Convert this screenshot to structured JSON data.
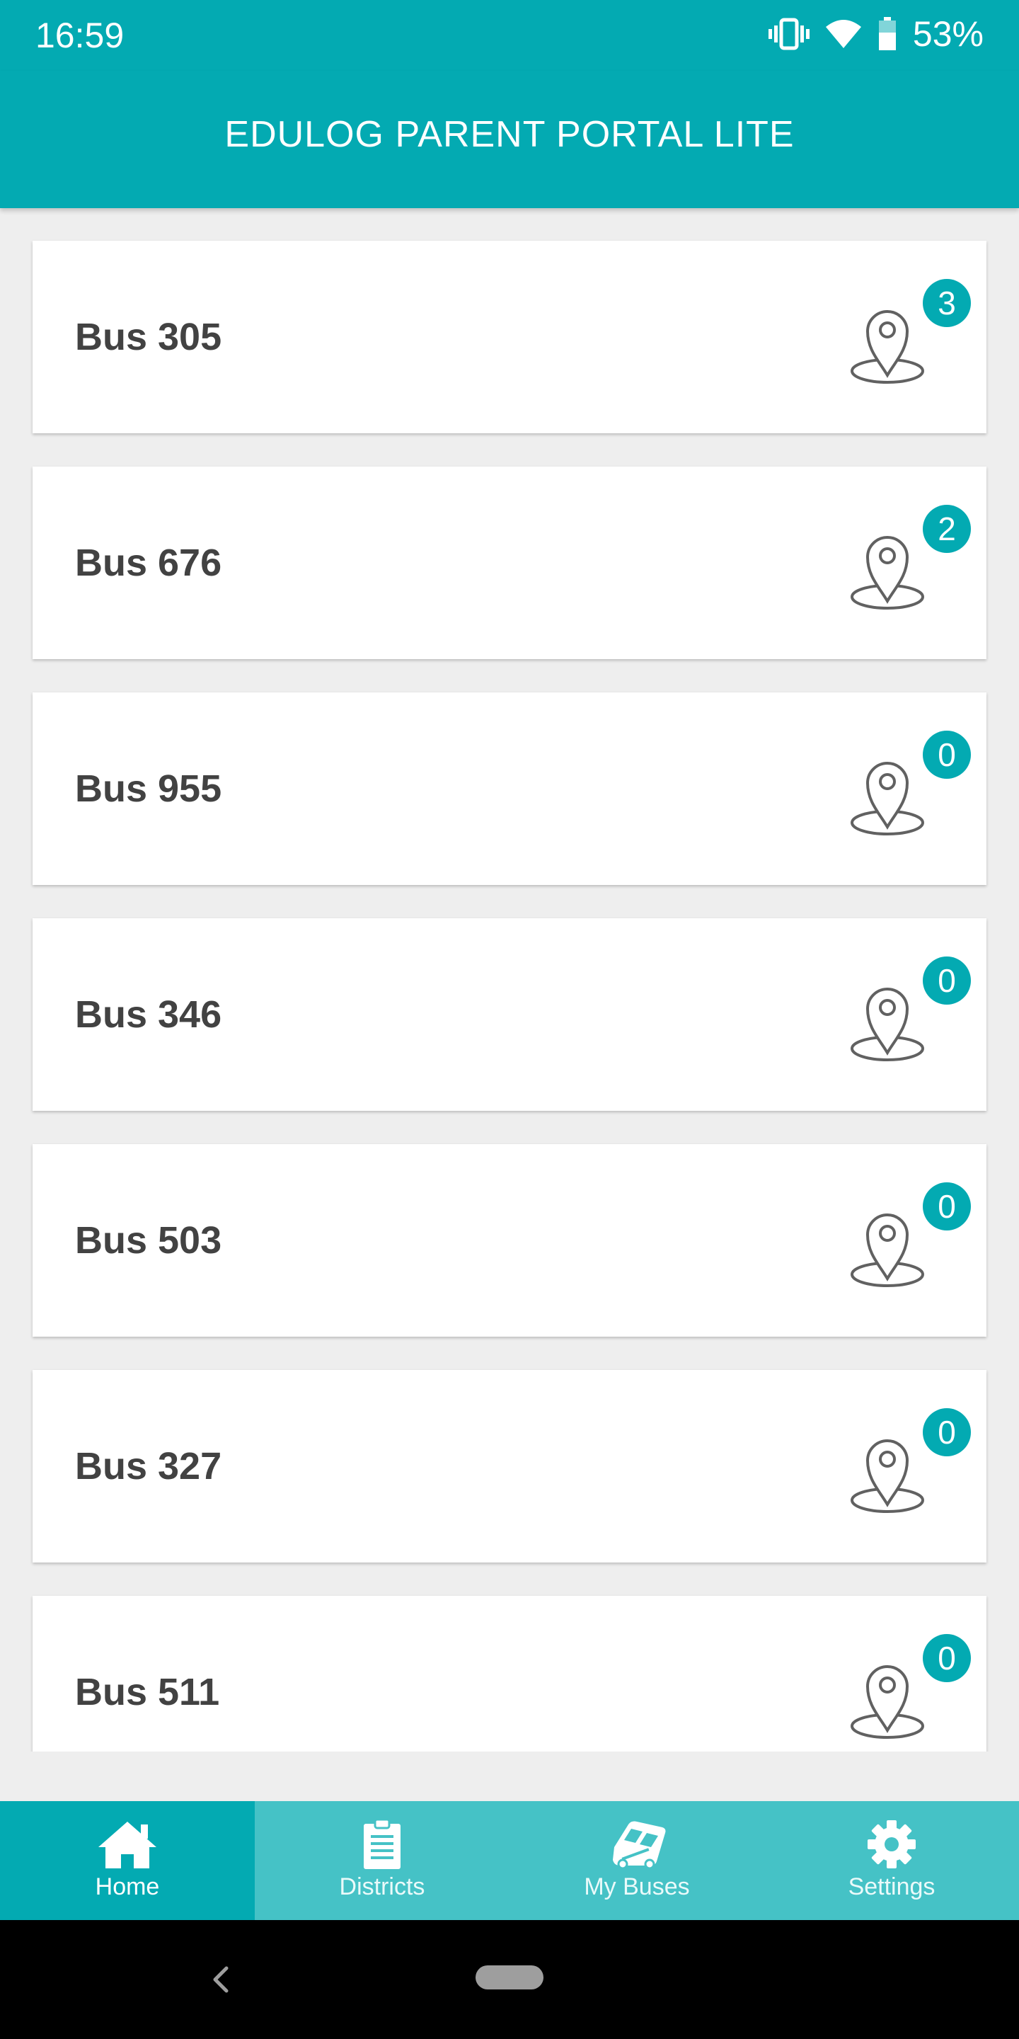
{
  "status_bar": {
    "time": "16:59",
    "battery": "53%",
    "icons": [
      "vibrate-icon",
      "wifi-icon",
      "battery-icon"
    ]
  },
  "header": {
    "title": "EDULOG PARENT PORTAL LITE"
  },
  "buses": [
    {
      "name": "Bus 305",
      "stops": "3"
    },
    {
      "name": "Bus 676",
      "stops": "2"
    },
    {
      "name": "Bus 955",
      "stops": "0"
    },
    {
      "name": "Bus 346",
      "stops": "0"
    },
    {
      "name": "Bus 503",
      "stops": "0"
    },
    {
      "name": "Bus 327",
      "stops": "0"
    },
    {
      "name": "Bus 511",
      "stops": "0"
    }
  ],
  "bottom_nav": {
    "items": [
      {
        "label": "Home",
        "icon": "home-icon",
        "active": true
      },
      {
        "label": "Districts",
        "icon": "clipboard-icon",
        "active": false
      },
      {
        "label": "My Buses",
        "icon": "bus-icon",
        "active": false
      },
      {
        "label": "Settings",
        "icon": "gear-icon",
        "active": false
      }
    ]
  },
  "colors": {
    "primary": "#03aab2",
    "nav_inactive": "#45c2c6",
    "text_dark": "#424242",
    "background": "#eeeeee"
  }
}
